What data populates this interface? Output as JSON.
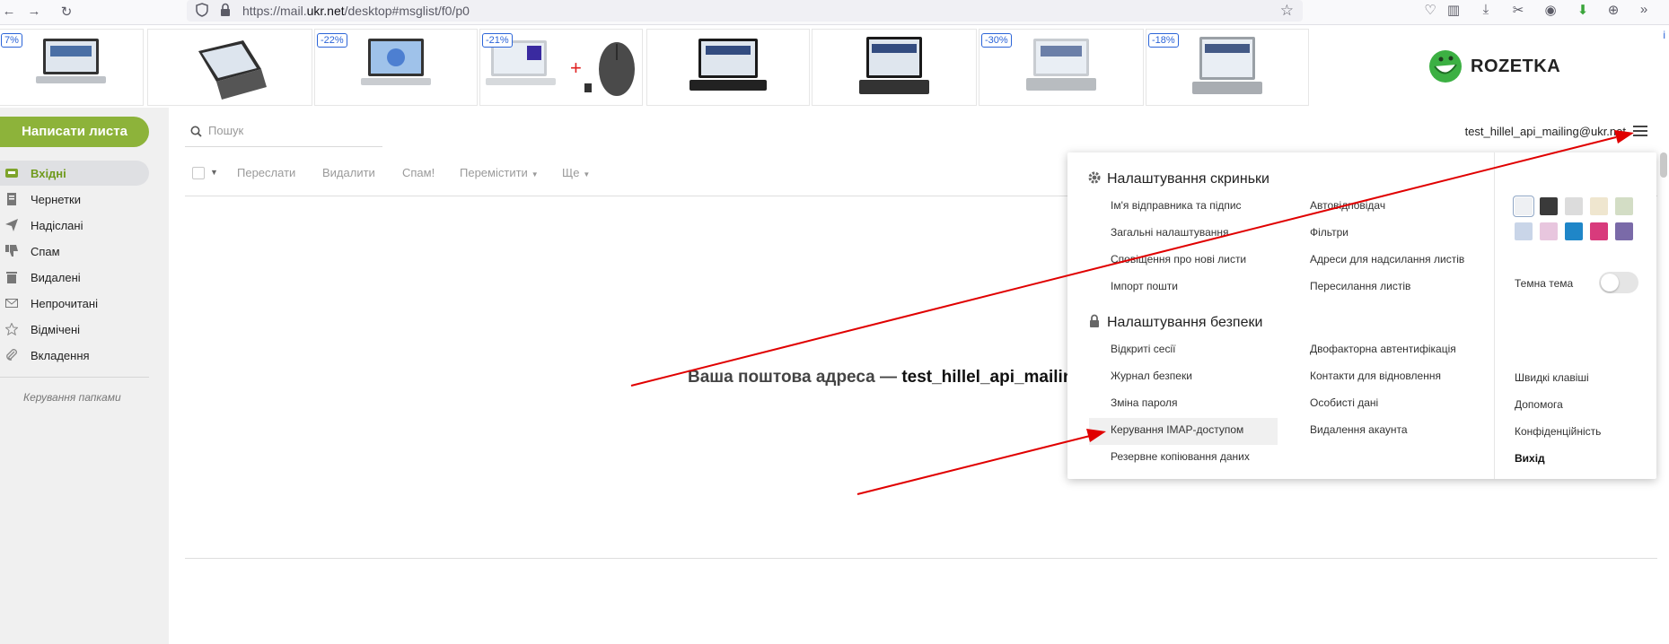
{
  "browser": {
    "url_prefix": "https://mail.",
    "url_domain": "ukr.net",
    "url_suffix": "/desktop#msglist/f0/p0",
    "icons": [
      "back-icon",
      "forward-icon",
      "reload-icon",
      "shield-icon",
      "lock-icon",
      "star-icon",
      "pocket-icon",
      "reader-icon",
      "download-icon",
      "screenshot-icon",
      "account-icon",
      "extension-icon",
      "globe-icon",
      "more-icon"
    ]
  },
  "ads": {
    "badges": [
      "7%",
      "-22%",
      "-21%",
      "-30%",
      "-18%"
    ],
    "brand": "ROZETKA",
    "info": "i"
  },
  "sidebar": {
    "compose": "Написати листа",
    "folders": [
      {
        "label": "Вхідні",
        "icon": "inbox-icon"
      },
      {
        "label": "Чернетки",
        "icon": "drafts-icon"
      },
      {
        "label": "Надіслані",
        "icon": "sent-icon"
      },
      {
        "label": "Спам",
        "icon": "spam-icon"
      },
      {
        "label": "Видалені",
        "icon": "trash-icon"
      },
      {
        "label": "Непрочитані",
        "icon": "unread-icon"
      },
      {
        "label": "Відмічені",
        "icon": "star-icon"
      },
      {
        "label": "Вкладення",
        "icon": "attachment-icon"
      }
    ],
    "manage_folders": "Керування папками"
  },
  "search": {
    "placeholder": "Пошук"
  },
  "user": {
    "email": "test_hillel_api_mailing@ukr.net"
  },
  "toolbar": {
    "forward": "Переслати",
    "delete": "Видалити",
    "spam": "Спам!",
    "move": "Перемістити",
    "more": "Ще"
  },
  "main": {
    "address_prefix": "Ваша поштова адреса — ",
    "address_email": "test_hillel_api_mailin"
  },
  "menu": {
    "mailbox_settings": {
      "title": "Налаштування скриньки",
      "col1": [
        "Ім'я відправника та підпис",
        "Загальні налаштування",
        "Сповіщення про нові листи",
        "Імпорт пошти"
      ],
      "col2": [
        "Автовідповідач",
        "Фільтри",
        "Адреси для надсилання листів",
        "Пересилання листів"
      ]
    },
    "security_settings": {
      "title": "Налаштування безпеки",
      "col1": [
        "Відкриті сесії",
        "Журнал безпеки",
        "Зміна пароля",
        "Керування IMAP-доступом",
        "Резервне копіювання даних"
      ],
      "col2": [
        "Двофакторна автентифікація",
        "Контакти для відновлення",
        "Особисті дані",
        "Видалення акаунта"
      ]
    },
    "themes": {
      "colors": [
        "#eef0f3",
        "#3a3a3a",
        "#dcdcdc",
        "#efe6cf",
        "#d3ddc5",
        "#c9d5e8",
        "#e8c6de",
        "#1f86c8",
        "#d83b7c",
        "#7a6aa8"
      ],
      "dark_theme_label": "Темна тема",
      "dark_theme_on": false
    },
    "right_links": [
      "Швидкі клавіші",
      "Допомога",
      "Конфіденційність"
    ],
    "logout": "Вихід"
  },
  "colors": {
    "accent_green": "#8db33a",
    "active_folder_text": "#6f9a1c",
    "annotation_red": "#e00000"
  }
}
